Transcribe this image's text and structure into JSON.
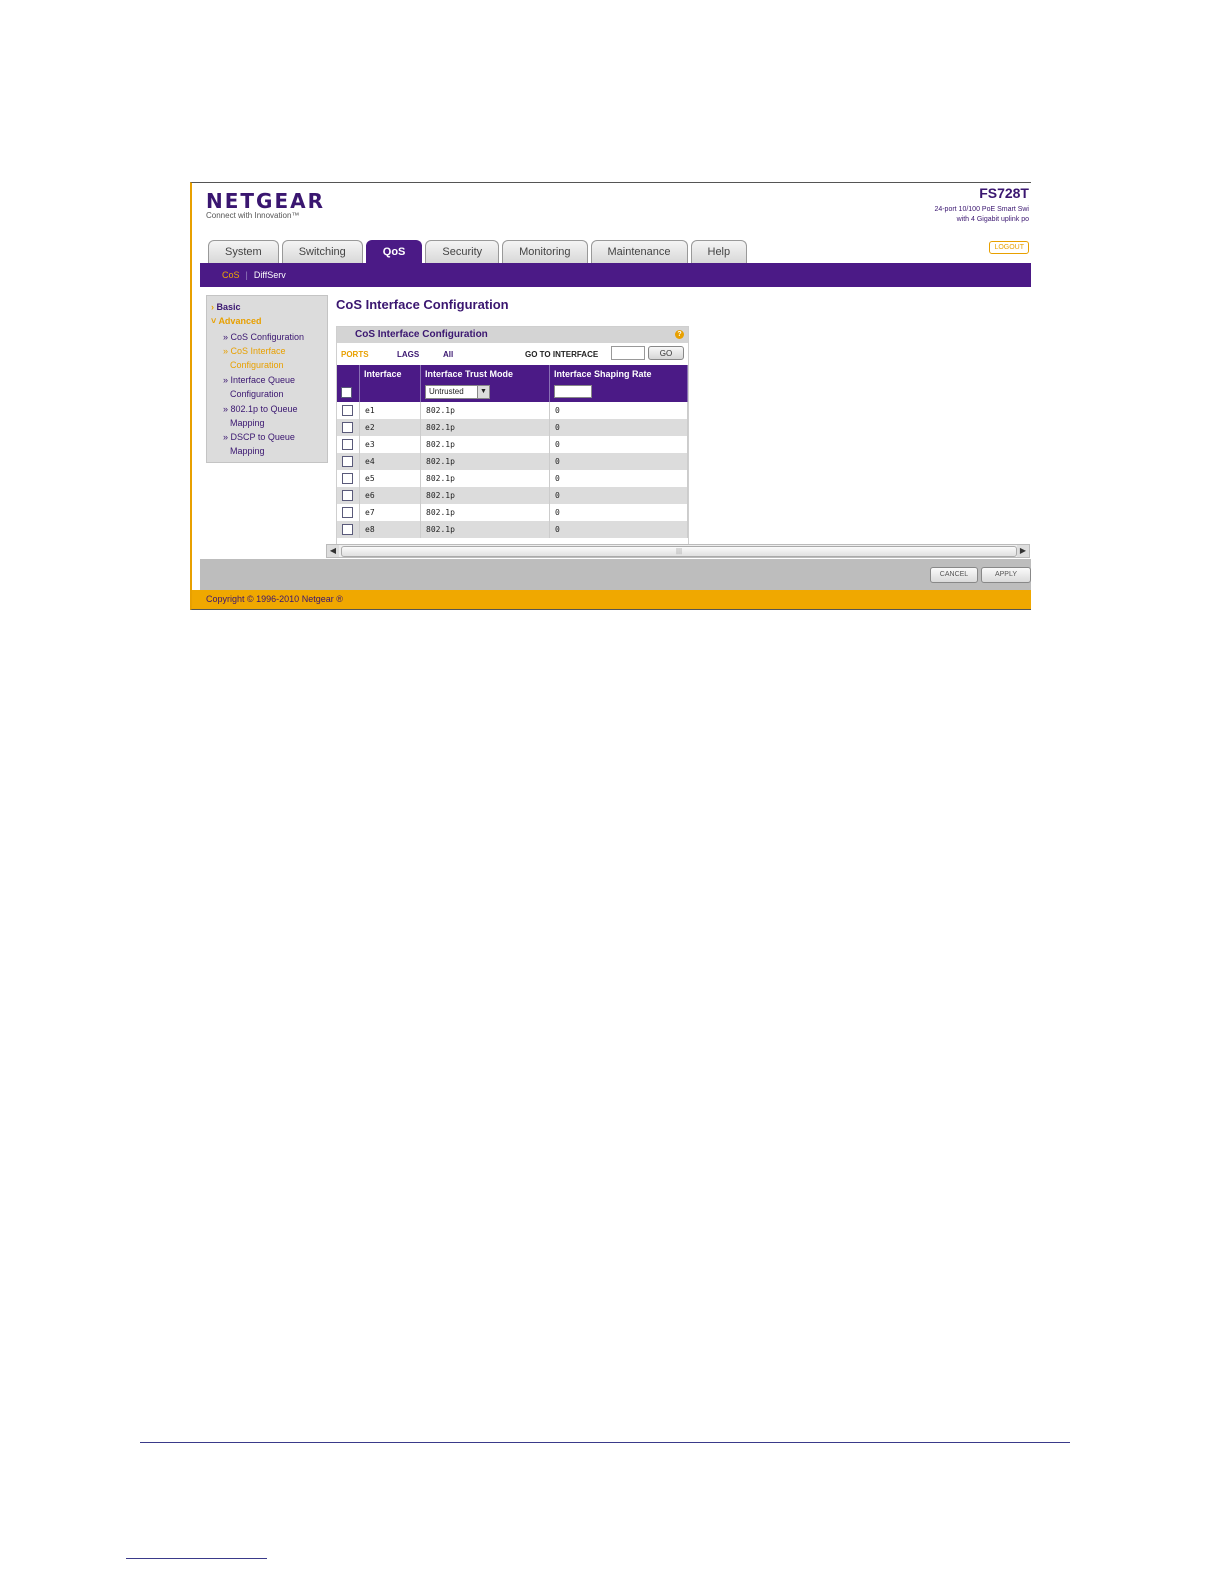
{
  "header": {
    "brand": "NETGEAR",
    "tagline": "Connect with Innovation™",
    "model": "FS728T",
    "model_desc_1": "24-port 10/100 PoE Smart Swi",
    "model_desc_2": "with 4 Gigabit uplink po",
    "logout": "LOGOUT"
  },
  "tabs": [
    "System",
    "Switching",
    "QoS",
    "Security",
    "Monitoring",
    "Maintenance",
    "Help"
  ],
  "active_tab": "QoS",
  "subnav": {
    "cos": "CoS",
    "diffserv": "DiffServ"
  },
  "sidebar": {
    "basic": "Basic",
    "advanced": "Advanced",
    "cos_config": "» CoS Configuration",
    "cos_interface_1": "» CoS Interface",
    "cos_interface_2": "Configuration",
    "iq_1": "» Interface Queue",
    "iq_2": "Configuration",
    "dot1p_1": "» 802.1p to Queue",
    "dot1p_2": "Mapping",
    "dscp_1": "» DSCP to Queue",
    "dscp_2": "Mapping"
  },
  "main": {
    "title": "CoS Interface Configuration",
    "panel_title": "CoS Interface Configuration",
    "filters": {
      "ports": "PORTS",
      "lags": "LAGS",
      "all": "All"
    },
    "goto_label": "GO TO INTERFACE",
    "go_button": "GO",
    "columns": [
      "Interface",
      "Interface Trust Mode",
      "Interface Shaping Rate"
    ],
    "trust_mode_select": "Untrusted",
    "rows": [
      {
        "iface": "e1",
        "mode": "802.1p",
        "rate": "0"
      },
      {
        "iface": "e2",
        "mode": "802.1p",
        "rate": "0"
      },
      {
        "iface": "e3",
        "mode": "802.1p",
        "rate": "0"
      },
      {
        "iface": "e4",
        "mode": "802.1p",
        "rate": "0"
      },
      {
        "iface": "e5",
        "mode": "802.1p",
        "rate": "0"
      },
      {
        "iface": "e6",
        "mode": "802.1p",
        "rate": "0"
      },
      {
        "iface": "e7",
        "mode": "802.1p",
        "rate": "0"
      },
      {
        "iface": "e8",
        "mode": "802.1p",
        "rate": "0"
      }
    ]
  },
  "buttons": {
    "cancel": "CANCEL",
    "apply": "APPLY"
  },
  "copyright": "Copyright © 1996-2010 Netgear ®",
  "colors": {
    "brand_purple": "#4b1a86",
    "accent_orange": "#f0a800"
  }
}
